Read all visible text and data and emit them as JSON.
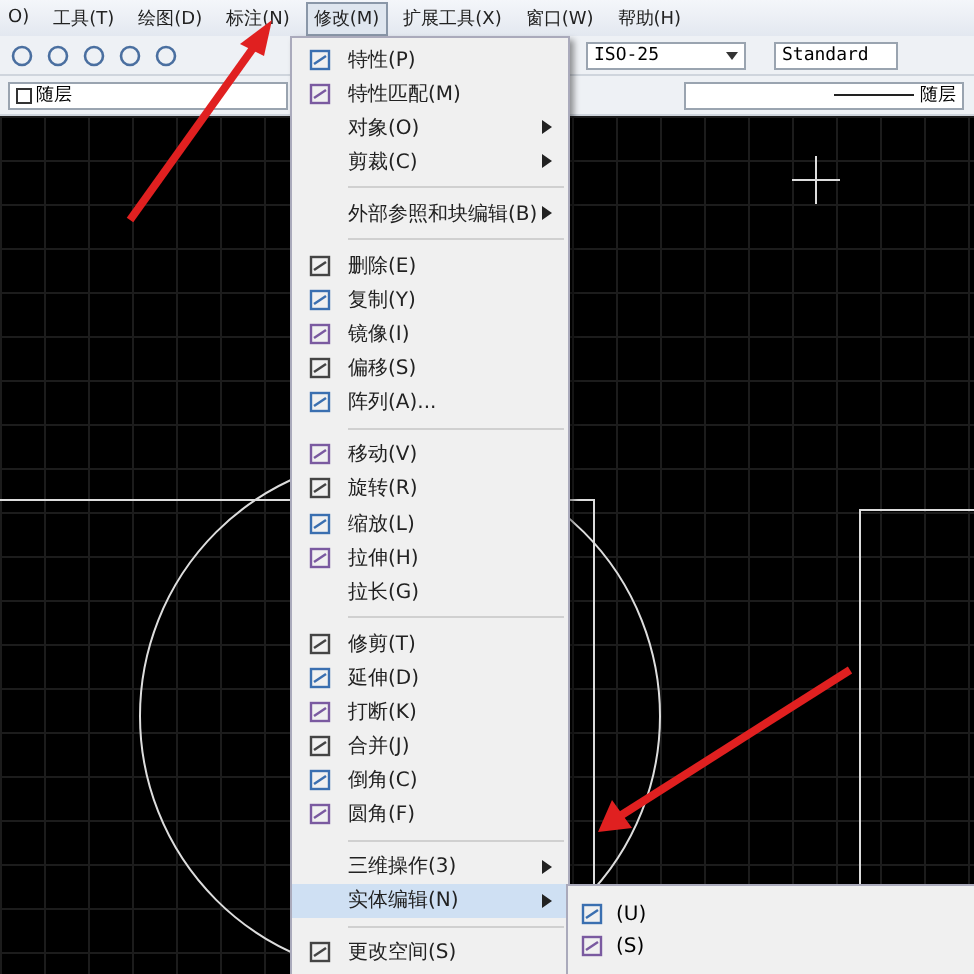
{
  "menubar": [
    {
      "label": "O)",
      "selected": false
    },
    {
      "label": "工具(T)",
      "selected": false
    },
    {
      "label": "绘图(D)",
      "selected": false
    },
    {
      "label": "标注(N)",
      "selected": false
    },
    {
      "label": "修改(M)",
      "selected": true
    },
    {
      "label": "扩展工具(X)",
      "selected": false
    },
    {
      "label": "窗口(W)",
      "selected": false
    },
    {
      "label": "帮助(H)",
      "selected": false
    }
  ],
  "toolbar": {
    "dimstyle": "ISO-25",
    "textstyle": "Standard"
  },
  "layer_bar": {
    "color_name": "随层",
    "linetype": "随层"
  },
  "menu": [
    {
      "kind": "item",
      "label": "特性(P)",
      "icon": true,
      "submenu": false,
      "selected": false
    },
    {
      "kind": "item",
      "label": "特性匹配(M)",
      "icon": true,
      "submenu": false,
      "selected": false
    },
    {
      "kind": "item",
      "label": "对象(O)",
      "icon": false,
      "submenu": true,
      "selected": false
    },
    {
      "kind": "item",
      "label": "剪裁(C)",
      "icon": false,
      "submenu": true,
      "selected": false
    },
    {
      "kind": "separator"
    },
    {
      "kind": "item",
      "label": "外部参照和块编辑(B)",
      "icon": false,
      "submenu": true,
      "selected": false
    },
    {
      "kind": "separator"
    },
    {
      "kind": "item",
      "label": "删除(E)",
      "icon": true,
      "submenu": false,
      "selected": false
    },
    {
      "kind": "item",
      "label": "复制(Y)",
      "icon": true,
      "submenu": false,
      "selected": false
    },
    {
      "kind": "item",
      "label": "镜像(I)",
      "icon": true,
      "submenu": false,
      "selected": false
    },
    {
      "kind": "item",
      "label": "偏移(S)",
      "icon": true,
      "submenu": false,
      "selected": false
    },
    {
      "kind": "item",
      "label": "阵列(A)...",
      "icon": true,
      "submenu": false,
      "selected": false
    },
    {
      "kind": "separator"
    },
    {
      "kind": "item",
      "label": "移动(V)",
      "icon": true,
      "submenu": false,
      "selected": false
    },
    {
      "kind": "item",
      "label": "旋转(R)",
      "icon": true,
      "submenu": false,
      "selected": false
    },
    {
      "kind": "item",
      "label": "缩放(L)",
      "icon": true,
      "submenu": false,
      "selected": false
    },
    {
      "kind": "item",
      "label": "拉伸(H)",
      "icon": true,
      "submenu": false,
      "selected": false
    },
    {
      "kind": "item",
      "label": "拉长(G)",
      "icon": false,
      "submenu": false,
      "selected": false
    },
    {
      "kind": "separator"
    },
    {
      "kind": "item",
      "label": "修剪(T)",
      "icon": true,
      "submenu": false,
      "selected": false
    },
    {
      "kind": "item",
      "label": "延伸(D)",
      "icon": true,
      "submenu": false,
      "selected": false
    },
    {
      "kind": "item",
      "label": "打断(K)",
      "icon": true,
      "submenu": false,
      "selected": false
    },
    {
      "kind": "item",
      "label": "合并(J)",
      "icon": true,
      "submenu": false,
      "selected": false
    },
    {
      "kind": "item",
      "label": "倒角(C)",
      "icon": true,
      "submenu": false,
      "selected": false
    },
    {
      "kind": "item",
      "label": "圆角(F)",
      "icon": true,
      "submenu": false,
      "selected": false
    },
    {
      "kind": "separator"
    },
    {
      "kind": "item",
      "label": "三维操作(3)",
      "icon": false,
      "submenu": true,
      "selected": false
    },
    {
      "kind": "item",
      "label": "实体编辑(N)",
      "icon": false,
      "submenu": true,
      "selected": true
    },
    {
      "kind": "separator"
    },
    {
      "kind": "item",
      "label": "更改空间(S)",
      "icon": true,
      "submenu": false,
      "selected": false
    }
  ],
  "submenu": [
    {
      "label": "(U)"
    },
    {
      "label": "(S)"
    }
  ]
}
